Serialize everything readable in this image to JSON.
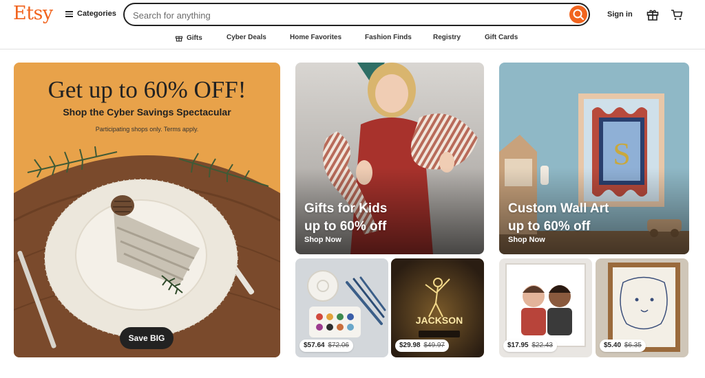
{
  "header": {
    "logo": "Etsy",
    "categories_label": "Categories",
    "search_placeholder": "Search for anything",
    "search_value": "",
    "signin_label": "Sign in"
  },
  "nav": {
    "items": [
      "Gifts",
      "Cyber Deals",
      "Home Favorites",
      "Fashion Finds",
      "Registry",
      "Gift Cards"
    ]
  },
  "hero": {
    "title": "Get up to 60% OFF!",
    "subtitle": "Shop the Cyber Savings Spectacular",
    "note": "Participating shops only. Terms apply.",
    "button_label": "Save BIG"
  },
  "promos": [
    {
      "title_line1": "Gifts for Kids",
      "title_line2": "up to 60% off",
      "link": "Shop Now"
    },
    {
      "title_line1": "Custom Wall Art",
      "title_line2": "up to 60% off",
      "link": "Shop Now"
    }
  ],
  "tiles": [
    {
      "price": "$57.64",
      "original": "$72.06"
    },
    {
      "price": "$29.98",
      "original": "$49.97"
    },
    {
      "price": "$17.95",
      "original": "$22.43"
    },
    {
      "price": "$5.40",
      "original": "$6.35"
    }
  ],
  "tile_art_text": {
    "lamp_name": "JACKSON",
    "monogram": "S"
  },
  "colors": {
    "brand": "#f1641e",
    "hero_bg": "#e8a24a",
    "text": "#222222"
  },
  "icons": [
    "menu-icon",
    "search-icon",
    "gift-icon",
    "cart-icon"
  ]
}
